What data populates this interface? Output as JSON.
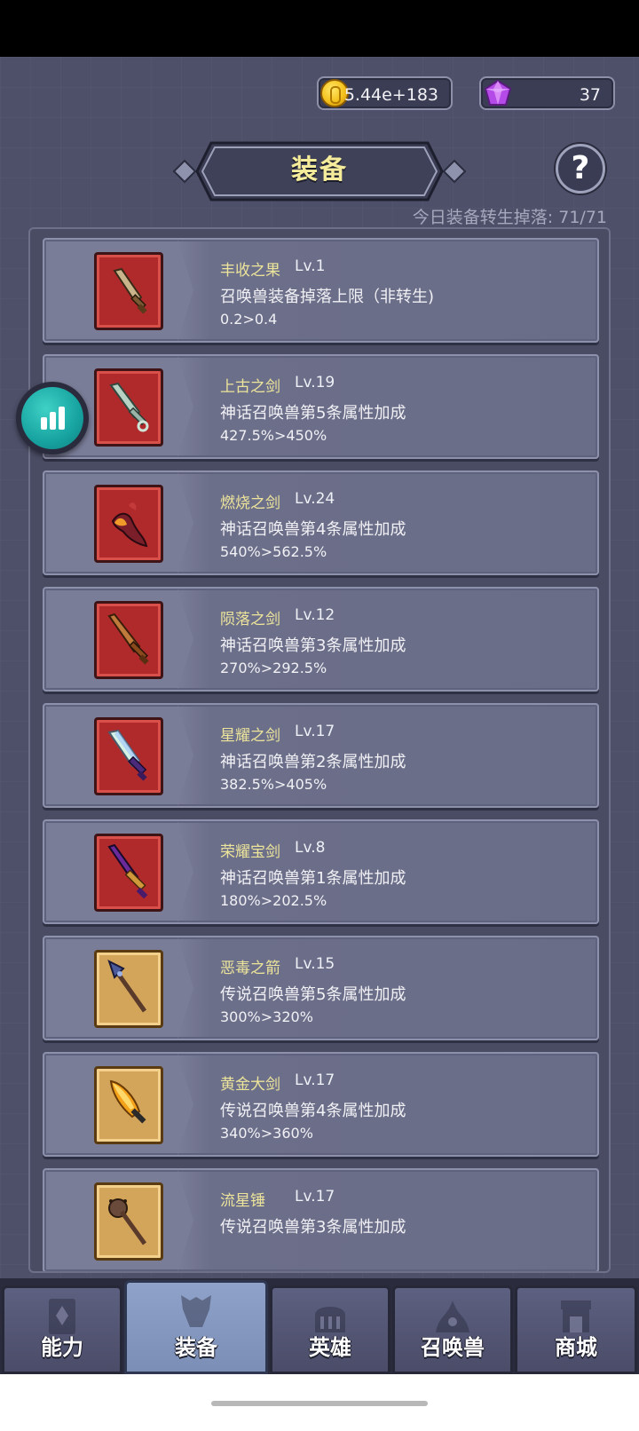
{
  "currency": {
    "gold": "5.44e+183",
    "gems": "37"
  },
  "header": {
    "title": "装备",
    "help_label": "?",
    "drop_info": "今日装备转生掉落: 71/71"
  },
  "equipment": [
    {
      "name": "丰收之果",
      "level": "Lv.1",
      "desc": "召唤兽装备掉落上限（非转生)",
      "value": "0.2>0.4",
      "icon": "brown-sword-icon",
      "frame": "red"
    },
    {
      "name": "上古之剑",
      "level": "Lv.19",
      "desc": "神话召唤兽第5条属性加成",
      "value": "427.5%>450%",
      "icon": "ancient-sword-icon",
      "frame": "red"
    },
    {
      "name": "燃烧之剑",
      "level": "Lv.24",
      "desc": "神话召唤兽第4条属性加成",
      "value": "540%>562.5%",
      "icon": "flame-sword-icon",
      "frame": "red"
    },
    {
      "name": "陨落之剑",
      "level": "Lv.12",
      "desc": "神话召唤兽第3条属性加成",
      "value": "270%>292.5%",
      "icon": "bronze-sword-icon",
      "frame": "red"
    },
    {
      "name": "星耀之剑",
      "level": "Lv.17",
      "desc": "神话召唤兽第2条属性加成",
      "value": "382.5%>405%",
      "icon": "star-sword-icon",
      "frame": "red"
    },
    {
      "name": "荣耀宝剑",
      "level": "Lv.8",
      "desc": "神话召唤兽第1条属性加成",
      "value": "180%>202.5%",
      "icon": "purple-sword-icon",
      "frame": "red"
    },
    {
      "name": "恶毒之箭",
      "level": "Lv.15",
      "desc": "传说召唤兽第5条属性加成",
      "value": "300%>320%",
      "icon": "poison-arrow-icon",
      "frame": "gold"
    },
    {
      "name": "黄金大剑",
      "level": "Lv.17",
      "desc": "传说召唤兽第4条属性加成",
      "value": "340%>360%",
      "icon": "golden-sword-icon",
      "frame": "gold"
    },
    {
      "name": "流星锤",
      "level": "Lv.17",
      "desc": "传说召唤兽第3条属性加成",
      "value": "",
      "icon": "meteor-hammer-icon",
      "frame": "gold"
    }
  ],
  "tabs": [
    {
      "label": "能力",
      "icon": "ability-icon"
    },
    {
      "label": "装备",
      "icon": "armor-icon",
      "active": true
    },
    {
      "label": "英雄",
      "icon": "hero-icon"
    },
    {
      "label": "召唤兽",
      "icon": "summon-icon"
    },
    {
      "label": "商城",
      "icon": "shop-icon"
    }
  ]
}
